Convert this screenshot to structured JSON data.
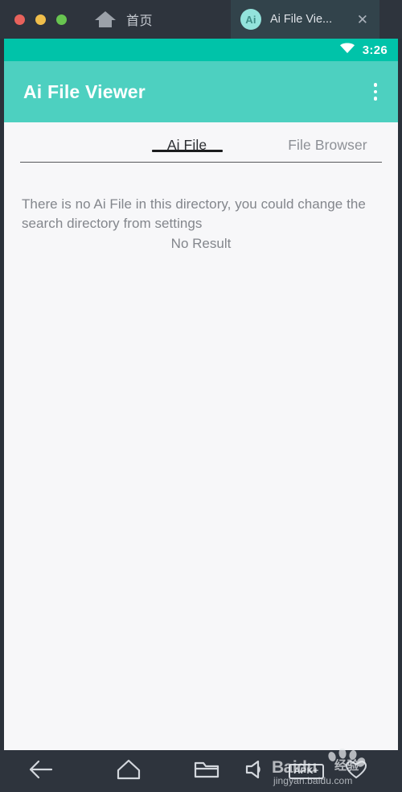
{
  "window": {
    "traffic_lights": [
      {
        "name": "close",
        "color": "#e8625c"
      },
      {
        "name": "minimize",
        "color": "#f0be4b"
      },
      {
        "name": "zoom",
        "color": "#68c550"
      }
    ],
    "home_tab_label": "首页",
    "app_tab": {
      "icon_text": "Ai",
      "label": "Ai File Vie...",
      "close_glyph": "✕"
    }
  },
  "status_bar": {
    "wifi_icon": "wifi-icon",
    "time": "3:26"
  },
  "app_bar": {
    "title": "Ai File Viewer",
    "overflow_icon": "overflow-menu-icon"
  },
  "tabs": [
    {
      "label": "Ai File",
      "active": true
    },
    {
      "label": "File Browser",
      "active": false
    }
  ],
  "empty_state": {
    "message": "There is no Ai File in this directory, you could change the search directory from settings",
    "result": "No Result"
  },
  "nav_bar": {
    "buttons": [
      {
        "name": "back-button",
        "icon": "arrow-left-icon"
      },
      {
        "name": "home-button",
        "icon": "home-outline-icon"
      },
      {
        "name": "recents-button",
        "icon": "folder-icon"
      },
      {
        "name": "volume-button",
        "icon": "speaker-icon"
      },
      {
        "name": "apk-button",
        "icon": "apk-plus-icon",
        "label": "APK+"
      },
      {
        "name": "favorite-button",
        "icon": "heart-icon"
      }
    ]
  },
  "watermark": {
    "brand": "Baidu",
    "brand_cn": "经验",
    "url": "jingyan.baidu.com"
  },
  "colors": {
    "status_bar_teal": "#00c3a9",
    "app_bar_teal": "#4dd0c0",
    "chrome_dark": "#2e343d",
    "content_bg": "#f7f7f9",
    "muted_text": "#83868c",
    "tab_indicator": "#1b1c1e"
  }
}
